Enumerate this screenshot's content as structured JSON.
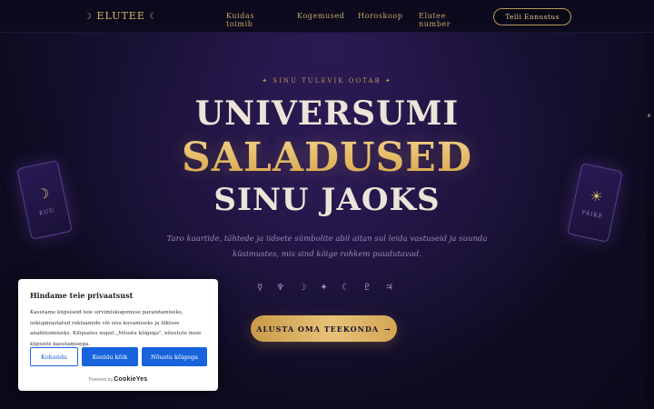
{
  "nav": {
    "brand": "ELUTEE",
    "brand_moon_left": "☽",
    "brand_moon_right": "☾",
    "links": [
      "Kuidas toimib",
      "Kogemused",
      "Horoskoop",
      "Elutee number"
    ],
    "cta": "Telli Ennustus"
  },
  "hero": {
    "eyebrow": "✦ SINU TULEVIK OOTAB ✦",
    "line1": "UNIVERSUMI",
    "line2": "SALADUSED",
    "line3": "SINU JAOKS",
    "description": "Taro kaartide, tähtede ja iidsete sümbolite abil aitan sul leida vastuseid ja suunda küsimustes, mis sind kõige rohkem puudutavad.",
    "symbols": [
      "☿",
      "♆",
      "☽",
      "✦",
      "☾",
      "♇",
      "♃"
    ],
    "cta_label": "ALUSTA OMA TEEKONDA",
    "cta_arrow": "→"
  },
  "cards": {
    "left": {
      "symbol": "☽",
      "label": "KUU"
    },
    "right": {
      "symbol": "☀",
      "label": "PÄIKE"
    }
  },
  "cookie": {
    "title": "Hindame teie privaatsust",
    "text": "Kasutame küpsiseid teie sirvimiskogemuse parandamiseks, isikupärastatud reklaamide või sisu kuvamiseks ja liikluse analüüsimiseks. Klõpsates nupul „Nõustu kõigega\", nõustute meie küpsiste kasutamisega.",
    "customize": "Kohanda",
    "reject": "Keeldu kõik",
    "accept": "Nõustu kõigega",
    "powered_by": "Powered by",
    "powered_brand": "CookieYes"
  },
  "colors": {
    "gold": "#d8b86a",
    "accent_blue": "#1863dc",
    "background": "#0f0c22"
  }
}
